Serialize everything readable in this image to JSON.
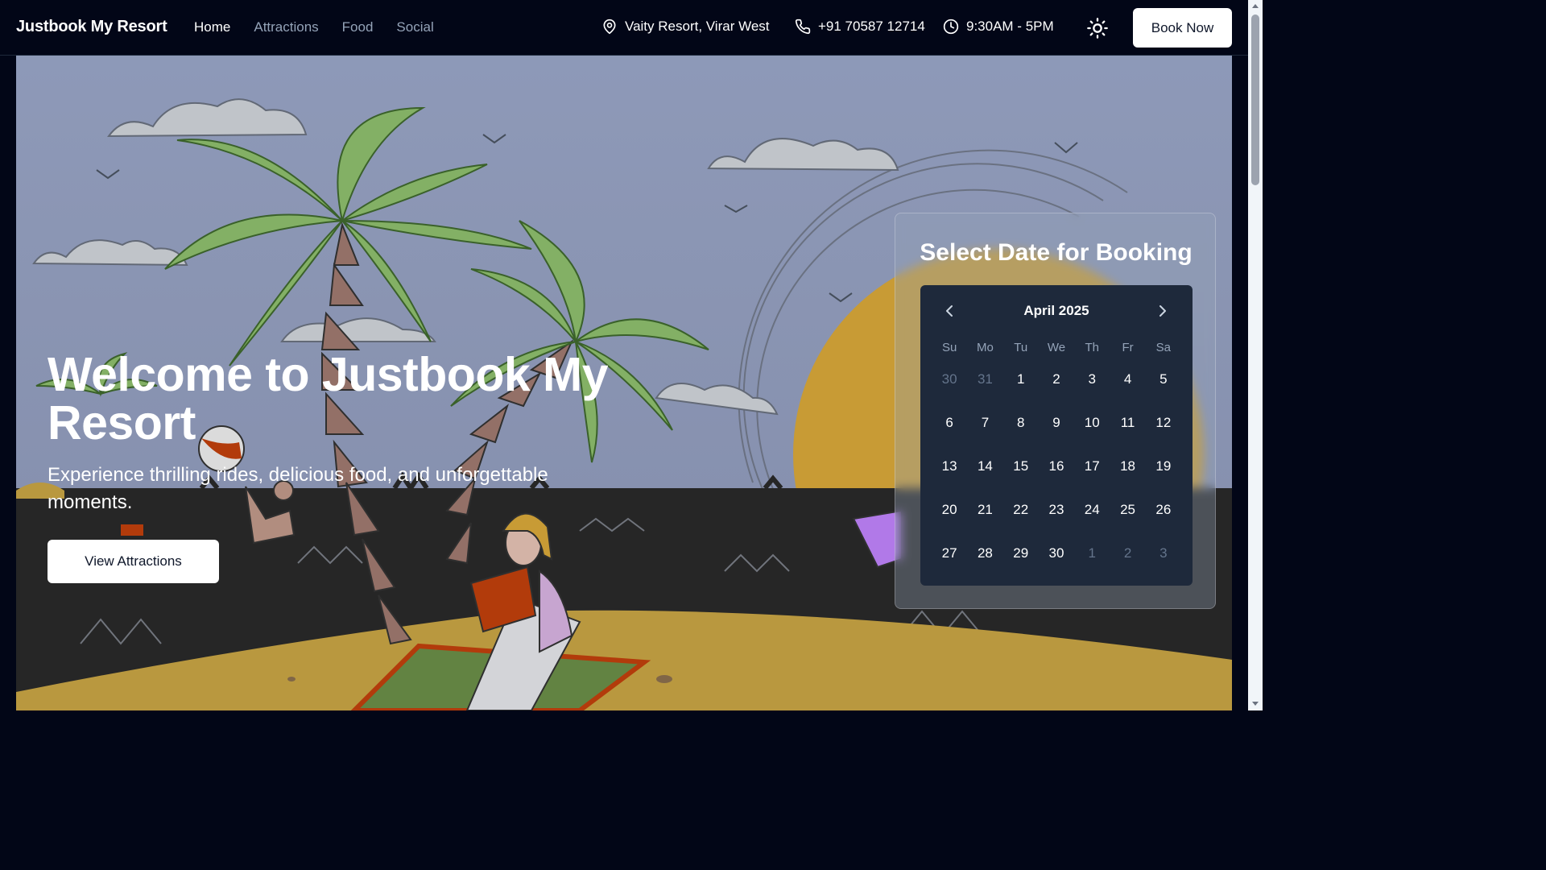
{
  "nav": {
    "brand": "Justbook My Resort",
    "links": [
      "Home",
      "Attractions",
      "Food",
      "Social"
    ],
    "location": "Vaity Resort, Virar West",
    "phone": "+91 70587 12714",
    "hours": "9:30AM - 5PM",
    "book_label": "Book Now"
  },
  "hero": {
    "title": "Welcome to Justbook My Resort",
    "subtitle": "Experience thrilling rides, delicious food, and unforgettable moments.",
    "cta_label": "View Attractions"
  },
  "booking": {
    "title": "Select Date for Booking",
    "month_label": "April 2025",
    "weekdays": [
      "Su",
      "Mo",
      "Tu",
      "We",
      "Th",
      "Fr",
      "Sa"
    ],
    "weeks": [
      [
        {
          "d": "30",
          "out": true
        },
        {
          "d": "31",
          "out": true
        },
        {
          "d": "1"
        },
        {
          "d": "2"
        },
        {
          "d": "3"
        },
        {
          "d": "4"
        },
        {
          "d": "5"
        }
      ],
      [
        {
          "d": "6"
        },
        {
          "d": "7"
        },
        {
          "d": "8"
        },
        {
          "d": "9"
        },
        {
          "d": "10"
        },
        {
          "d": "11"
        },
        {
          "d": "12"
        }
      ],
      [
        {
          "d": "13"
        },
        {
          "d": "14"
        },
        {
          "d": "15"
        },
        {
          "d": "16"
        },
        {
          "d": "17"
        },
        {
          "d": "18"
        },
        {
          "d": "19"
        }
      ],
      [
        {
          "d": "20"
        },
        {
          "d": "21"
        },
        {
          "d": "22"
        },
        {
          "d": "23"
        },
        {
          "d": "24"
        },
        {
          "d": "25"
        },
        {
          "d": "26"
        }
      ],
      [
        {
          "d": "27"
        },
        {
          "d": "28"
        },
        {
          "d": "29"
        },
        {
          "d": "30"
        },
        {
          "d": "1",
          "out": true
        },
        {
          "d": "2",
          "out": true
        },
        {
          "d": "3",
          "out": true
        }
      ]
    ]
  },
  "icons": {
    "location": "map-pin-icon",
    "phone": "phone-icon",
    "hours": "clock-icon",
    "theme": "sun-icon",
    "prev": "chevron-left-icon",
    "next": "chevron-right-icon"
  },
  "colors": {
    "nav_bg": "#020617",
    "sky": "#9aa6c8",
    "sea": "#2a2a2a",
    "sand": "#c9a545",
    "sun": "#d9a93a",
    "palm_leaf": "#8fbf6e",
    "calendar_bg": "#1e293b",
    "button_bg": "#ffffff"
  }
}
